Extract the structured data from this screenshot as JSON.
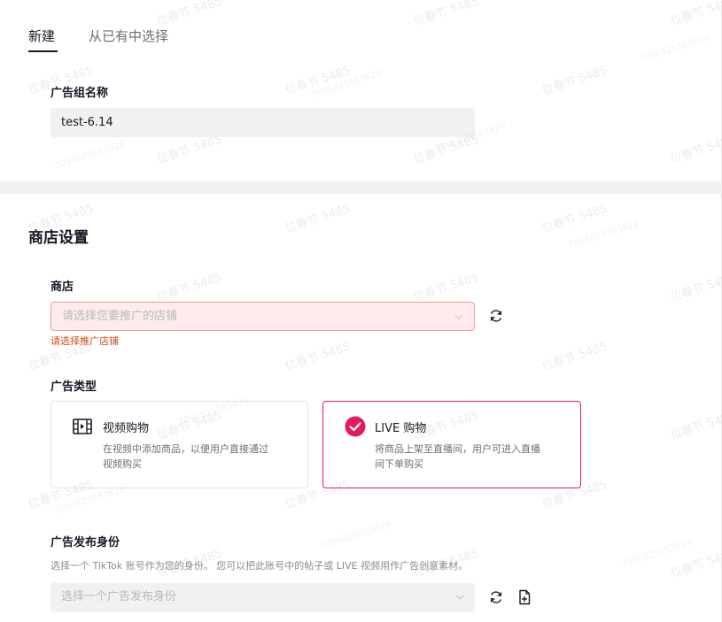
{
  "tabs": [
    {
      "label": "新建",
      "active": true
    },
    {
      "label": "从已有中选择",
      "active": false
    }
  ],
  "ad_group_name": {
    "label": "广告组名称",
    "value": "test-6.14"
  },
  "shop_settings": {
    "title": "商店设置",
    "shop": {
      "label": "商店",
      "placeholder": "请选择您要推广的店铺",
      "error": "请选择推广店铺"
    },
    "ad_type": {
      "label": "广告类型",
      "options": [
        {
          "title": "视频购物",
          "description_line1": "在视频中添加商品，以便用户直接通过",
          "description_line2": "视频购买",
          "selected": false,
          "icon": "film-icon"
        },
        {
          "title": "LIVE 购物",
          "description_line1": "将商品上架至直播间，用户可进入直播",
          "description_line2": "间下单购买",
          "selected": true,
          "icon": "check-circle-icon"
        }
      ]
    },
    "publisher": {
      "label": "广告发布身份",
      "helper": "选择一个 TikTok 账号作为您的身份。 您可以把此账号中的帖子或 LIVE 视频用作广告创意素材。",
      "placeholder": "选择一个广告发布身份"
    }
  },
  "watermark": {
    "text": "位春节 5485",
    "id_text": "7096825563829"
  },
  "colors": {
    "accent": "#e5195d",
    "error": "#d14a12",
    "error_border": "#f39a93",
    "error_bg": "#fdeceb"
  }
}
